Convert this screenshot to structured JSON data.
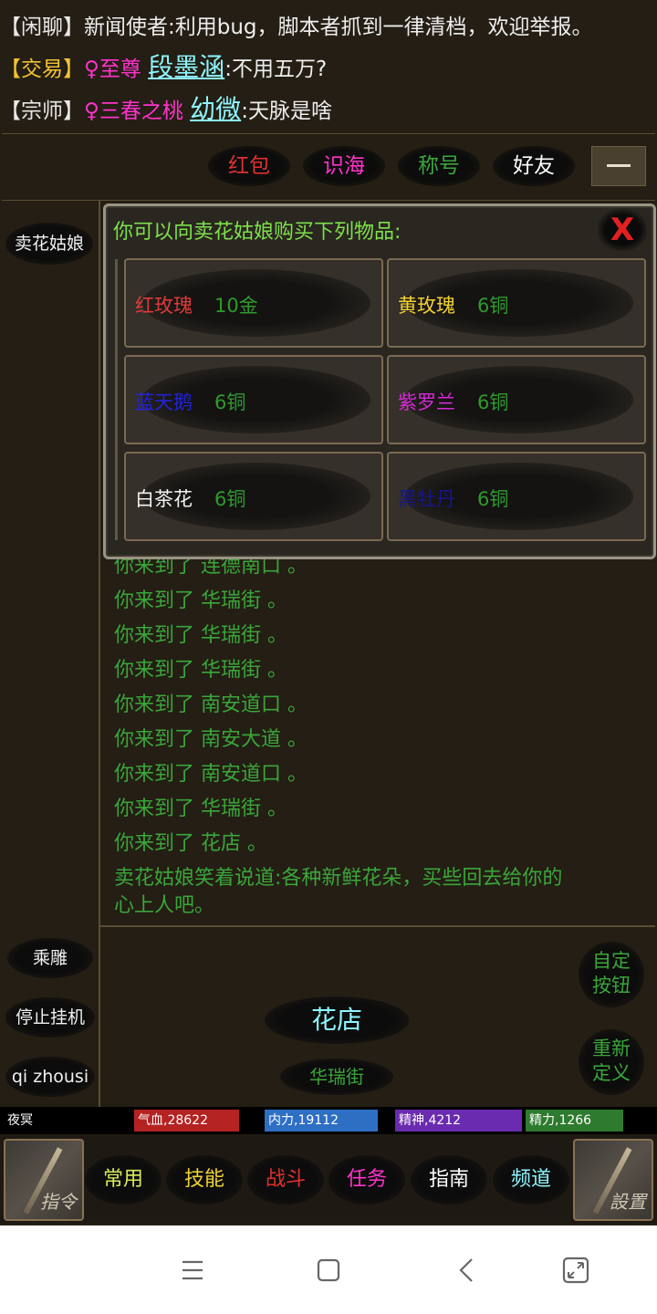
{
  "chat": [
    {
      "tag": "【闲聊】",
      "name": "新闻使者",
      "sep": ":",
      "message": "利用bug，脚本者抓到一律清档，欢迎举报。"
    },
    {
      "tag": "【交易】",
      "gender": "♀",
      "title": "至尊",
      "name": "段墨涵",
      "sep": ":",
      "message": "不用五万?"
    },
    {
      "tag": "【宗师】",
      "gender": "♀",
      "title": "三春之桃",
      "name": "幼微",
      "sep": ":",
      "message": "天脉是啥"
    }
  ],
  "top_nav": [
    {
      "label": "红包",
      "color": "#e03030"
    },
    {
      "label": "识海",
      "color": "#ff33cc"
    },
    {
      "label": "称号",
      "color": "#3aa63a"
    },
    {
      "label": "好友",
      "color": "#ffffff"
    }
  ],
  "collapse_icon": "minus-icon",
  "npc_button": "卖花姑娘",
  "dialog": {
    "title": "你可以向卖花姑娘购买下列物品:",
    "close_label": "X",
    "items": [
      {
        "name": "红玫瑰",
        "price": "10金",
        "color": "#e03a3a"
      },
      {
        "name": "黄玫瑰",
        "price": "6铜",
        "color": "#f1d232"
      },
      {
        "name": "蓝天鹅",
        "price": "6铜",
        "color": "#2323d8"
      },
      {
        "name": "紫罗兰",
        "price": "6铜",
        "color": "#d62ad6"
      },
      {
        "name": "白茶花",
        "price": "6铜",
        "color": "#f2f2f2"
      },
      {
        "name": "黑牡丹",
        "price": "6铜",
        "color": "#161690"
      }
    ]
  },
  "log": [
    "你来到了 连德南口 。",
    "你来到了 华瑞街 。",
    "你来到了 华瑞街 。",
    "你来到了 华瑞街 。",
    "你来到了 南安道口 。",
    "你来到了 南安大道 。",
    "你来到了 南安道口 。",
    "你来到了 华瑞街 。",
    "你来到了 花店 。",
    "卖花姑娘笑着说道:各种新鲜花朵，买些回去给你的",
    "心上人吧。"
  ],
  "left_buttons": [
    "乘雕",
    "停止挂机",
    "qi zhousi"
  ],
  "location": {
    "current": "花店",
    "exit": "华瑞街"
  },
  "right_buttons": [
    {
      "line1": "自定",
      "line2": "按钮"
    },
    {
      "line1": "重新",
      "line2": "定义"
    }
  ],
  "stats": {
    "player": "夜冥",
    "hp": "气血,28622",
    "mp": "内力,19112",
    "spirit": "精神,4212",
    "energy": "精力,1266",
    "hp_color": "#b52222",
    "mp_color": "#2e6fc4",
    "spirit_color": "#6a2bb0",
    "energy_color": "#2e7a2e"
  },
  "bottom_left": {
    "label": "指令",
    "icon": "brush-icon"
  },
  "bottom_right": {
    "label": "設置",
    "icon": "brush-icon"
  },
  "tabs": [
    {
      "label": "常用",
      "color": "#d9ea5a"
    },
    {
      "label": "技能",
      "color": "#f1d232"
    },
    {
      "label": "战斗",
      "color": "#e03030"
    },
    {
      "label": "任务",
      "color": "#ff33cc"
    },
    {
      "label": "指南",
      "color": "#ffffff"
    },
    {
      "label": "频道",
      "color": "#8ef6ff"
    }
  ],
  "android_nav": [
    "menu-icon",
    "home-icon",
    "back-icon",
    "rotate-icon"
  ]
}
